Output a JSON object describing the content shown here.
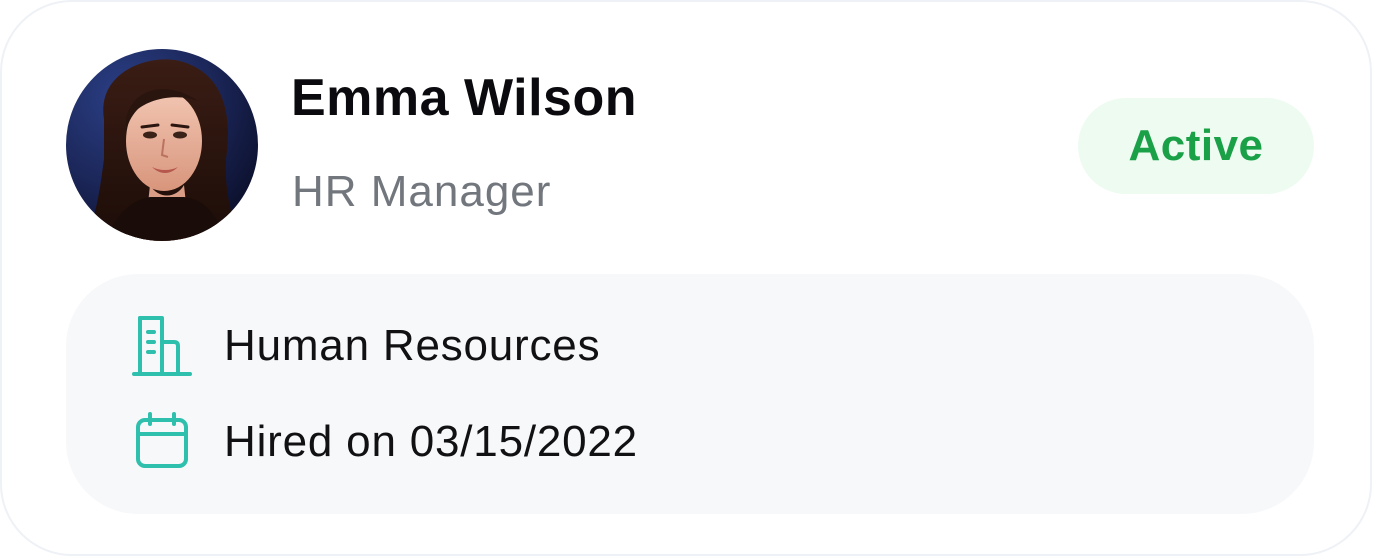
{
  "profile": {
    "name": "Emma Wilson",
    "role": "HR Manager",
    "status": "Active",
    "avatar_alt": "Emma Wilson"
  },
  "details": {
    "department": "Human Resources",
    "hired": "Hired on 03/15/2022"
  },
  "icons": {
    "department": "building-icon",
    "hired": "calendar-icon"
  },
  "colors": {
    "accent": "#2ebfad",
    "status_text": "#1aa148",
    "status_bg": "#edfbf1",
    "role_text": "#72767d"
  }
}
